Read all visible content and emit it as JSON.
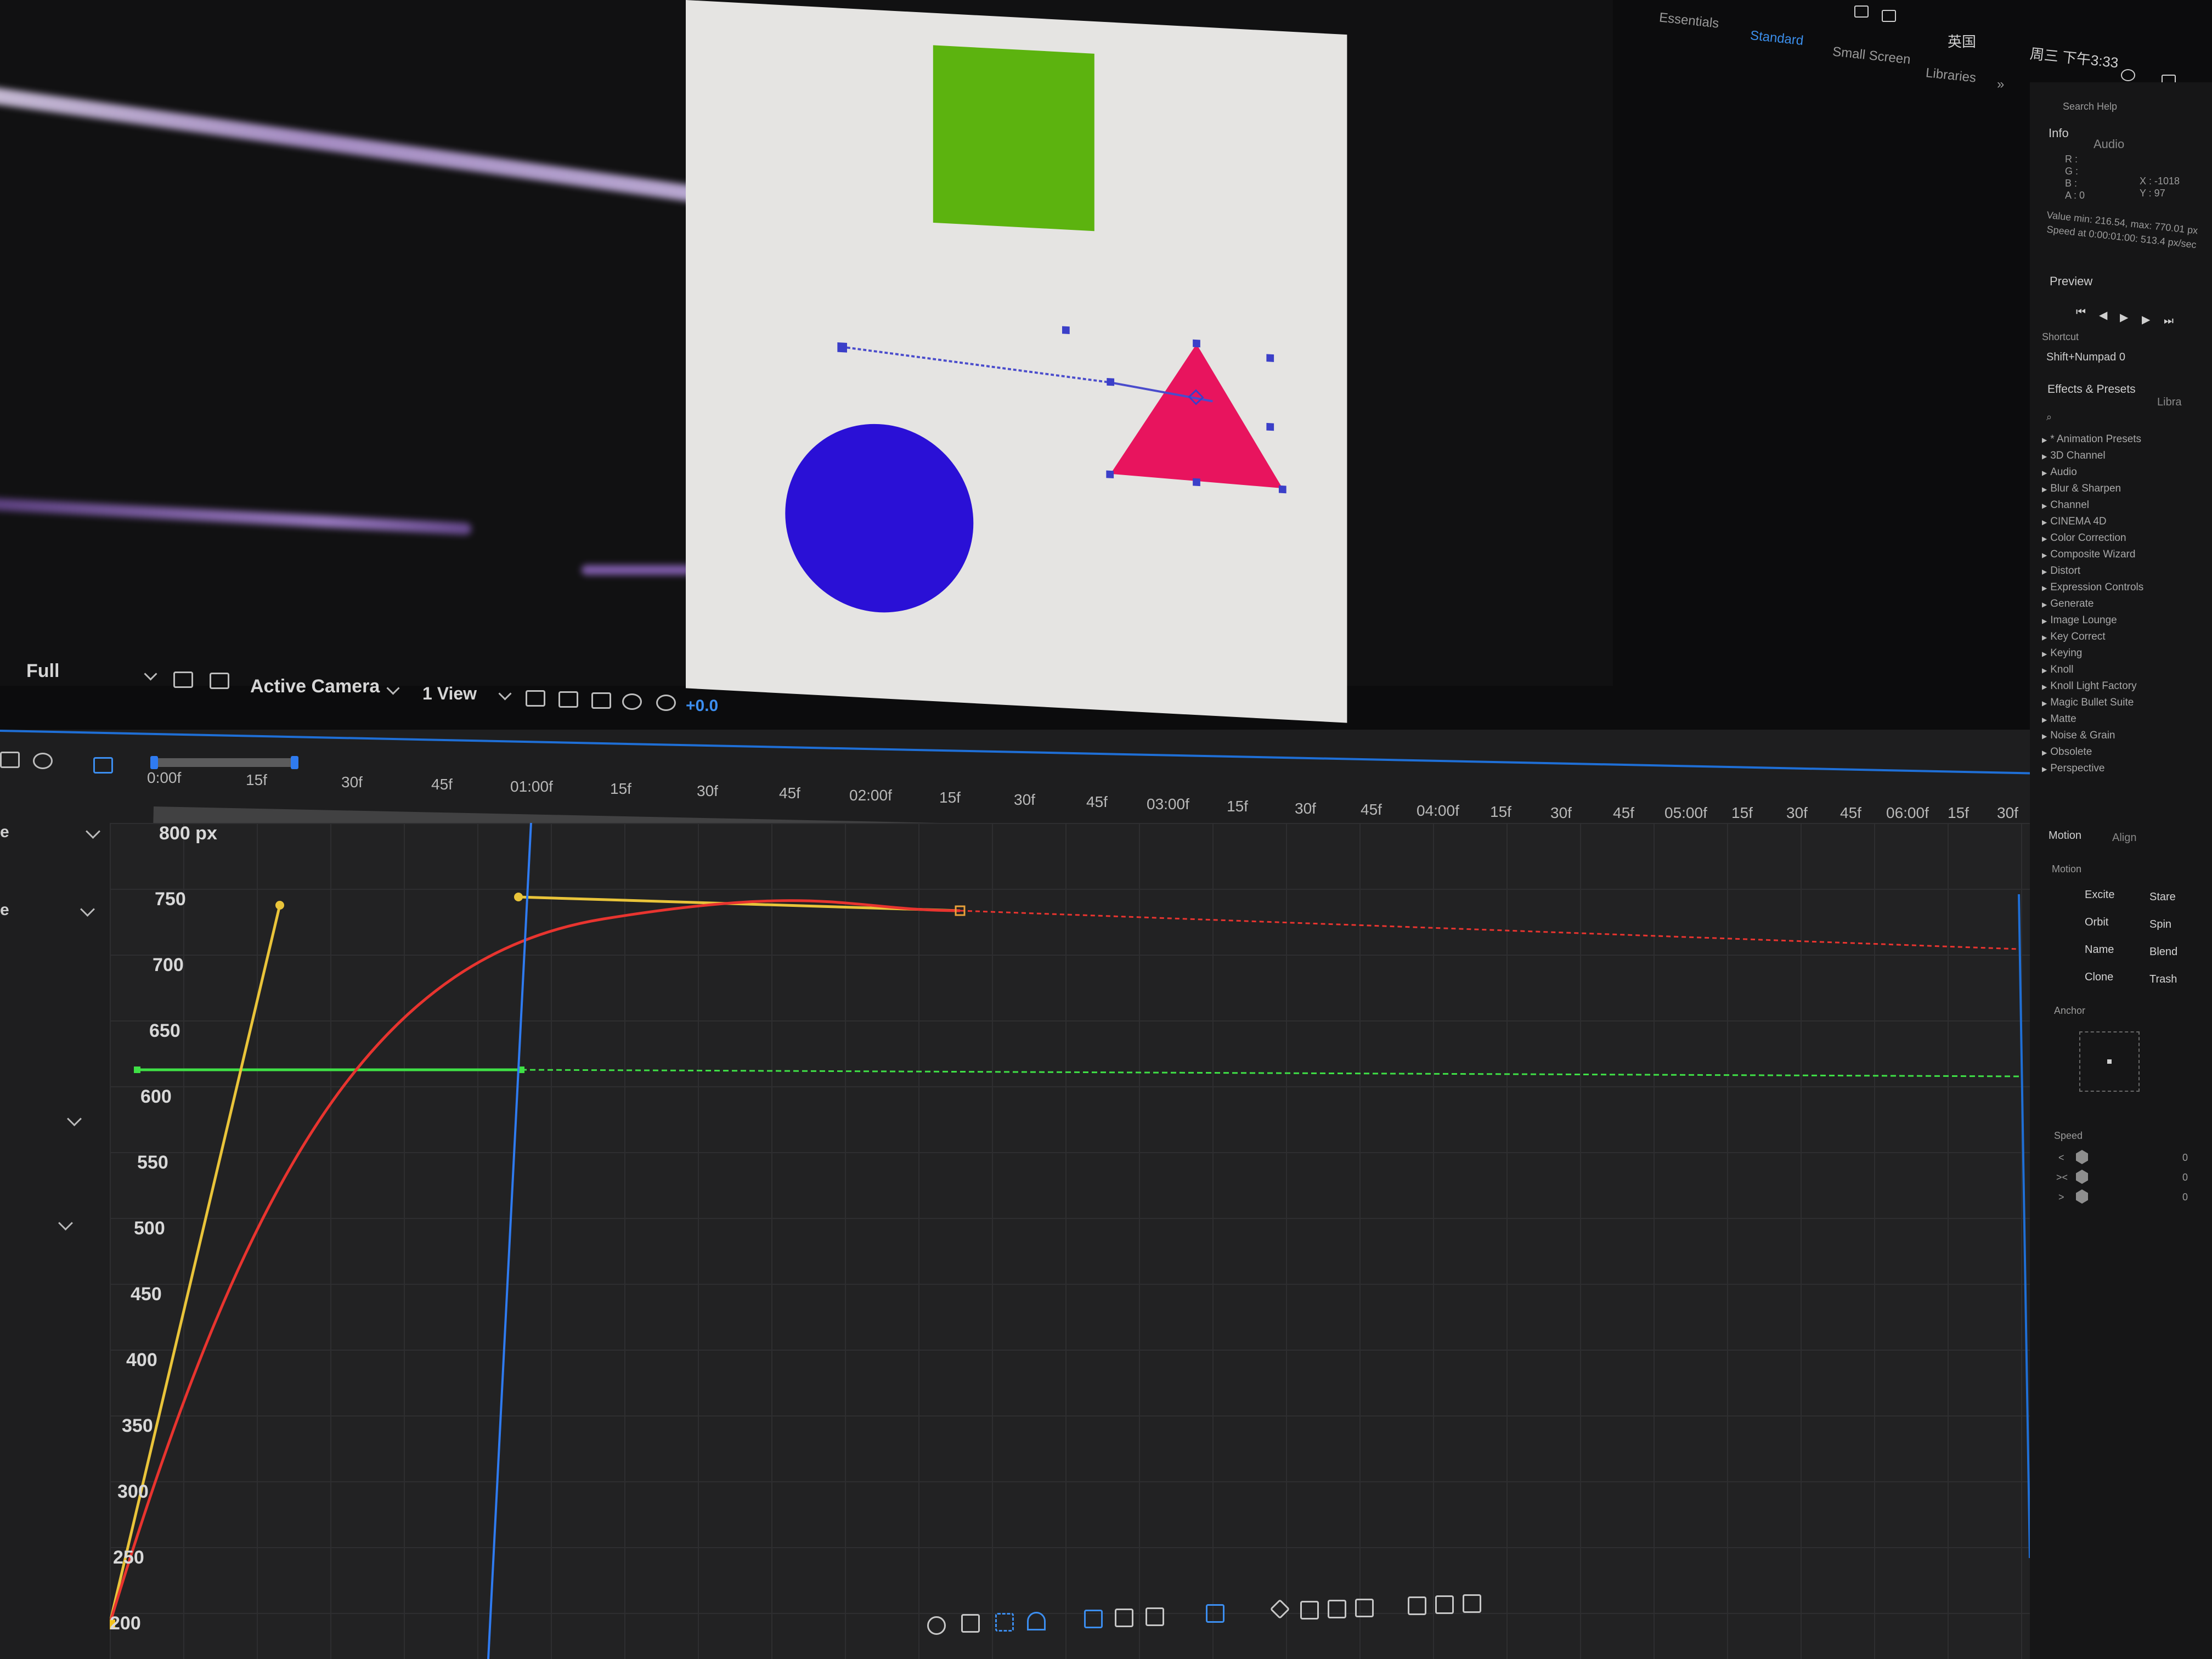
{
  "menubar": {
    "lang": "英国",
    "clock": "周三 下午3:33"
  },
  "workspaces": {
    "tabs": [
      "Essentials",
      "Standard",
      "Small Screen",
      "Libraries"
    ],
    "active": "Standard",
    "overflow": "»",
    "search_placeholder": "Search Help"
  },
  "viewer": {
    "resolution": "Full",
    "camera": "Active Camera",
    "views": "1 View",
    "exposure": "+0.0"
  },
  "timeline": {
    "ruler_labels": [
      "0:00f",
      "15f",
      "30f",
      "45f",
      "01:00f",
      "15f",
      "30f",
      "45f",
      "02:00f",
      "15f",
      "30f",
      "45f",
      "03:00f",
      "15f",
      "30f",
      "45f",
      "04:00f",
      "15f",
      "30f",
      "45f",
      "05:00f",
      "15f",
      "30f",
      "45f",
      "06:00f",
      "15f",
      "30f"
    ],
    "value_labels": [
      "800 px",
      "750",
      "700",
      "650",
      "600",
      "550",
      "500",
      "450",
      "400",
      "350",
      "300",
      "250",
      "200"
    ],
    "left_labels": [
      "e",
      "e"
    ]
  },
  "graph_curves": {
    "red_curve_color": "#e8342f",
    "yellow_handle_color": "#e9c43a",
    "green_value_color": "#3fe046",
    "playhead_color": "#2f7bf0"
  },
  "info_panel": {
    "tabs": [
      "Info",
      "Audio"
    ],
    "rgba": [
      "R :",
      "G :",
      "B :",
      "A : 0"
    ],
    "xy": [
      "X : -1018",
      "Y : 97"
    ],
    "value_line": "Value min: 216.54, max: 770.01 px",
    "speed_line": "Speed at 0:00:01:00: 513.4 px/sec"
  },
  "preview_panel": {
    "title": "Preview",
    "shortcut_label": "Shortcut",
    "shortcut_value": "Shift+Numpad 0"
  },
  "effects_panel": {
    "tabs": [
      "Effects & Presets",
      "Libra"
    ],
    "items": [
      "* Animation Presets",
      "3D Channel",
      "Audio",
      "Blur & Sharpen",
      "Channel",
      "CINEMA 4D",
      "Color Correction",
      "Composite Wizard",
      "Distort",
      "Expression Controls",
      "Generate",
      "Image Lounge",
      "Key Correct",
      "Keying",
      "Knoll",
      "Knoll Light Factory",
      "Magic Bullet Suite",
      "Matte",
      "Noise & Grain",
      "Obsolete",
      "Perspective"
    ]
  },
  "motion_panel": {
    "tabs": [
      "Motion",
      "Align"
    ],
    "title": "Motion",
    "buttons": [
      [
        "Excite",
        "Stare"
      ],
      [
        "Orbit",
        "Spin"
      ],
      [
        "Name",
        "Blend"
      ],
      [
        "Clone",
        "Trash"
      ]
    ],
    "anchor_label": "Anchor",
    "speed_label": "Speed",
    "speed_rows": [
      {
        "sym": "<",
        "val": "0"
      },
      {
        "sym": "><",
        "val": "0"
      },
      {
        "sym": ">",
        "val": "0"
      }
    ]
  }
}
